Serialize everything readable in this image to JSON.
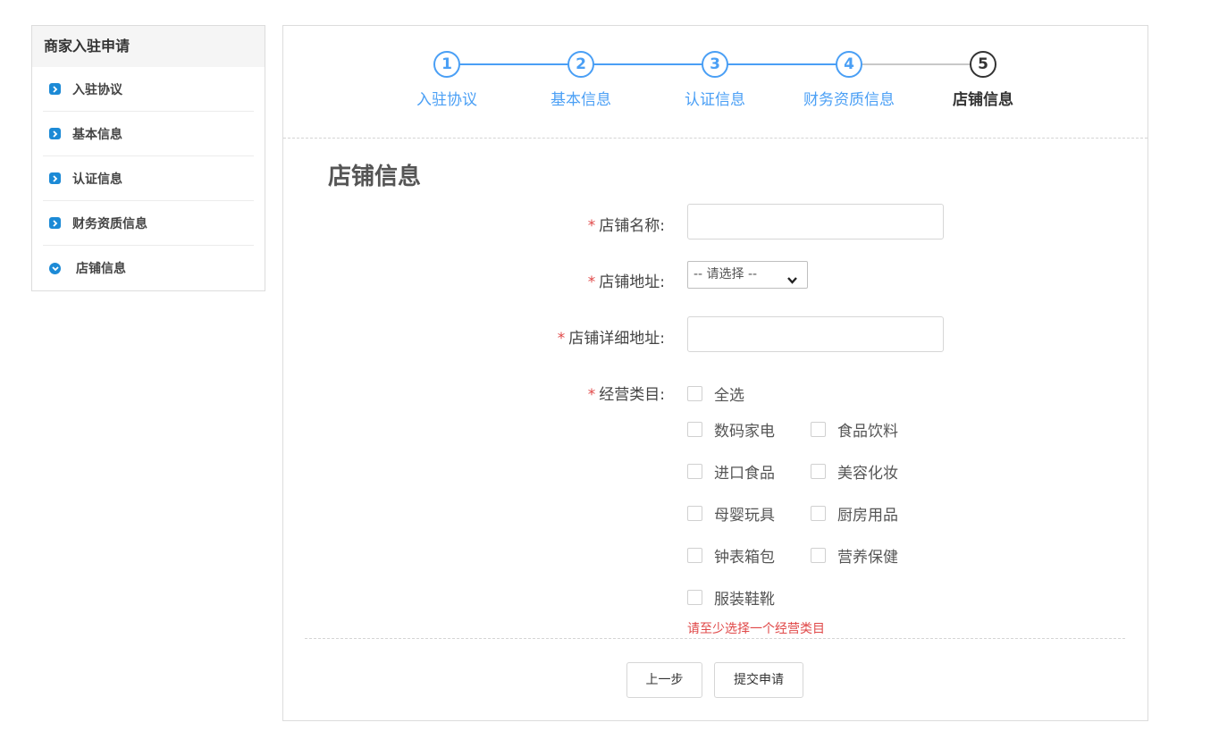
{
  "sidebar": {
    "title": "商家入驻申请",
    "items": [
      {
        "label": "入驻协议"
      },
      {
        "label": "基本信息"
      },
      {
        "label": "认证信息"
      },
      {
        "label": "财务资质信息"
      },
      {
        "label": "店铺信息"
      }
    ]
  },
  "stepper": {
    "steps": [
      {
        "number": "1",
        "label": "入驻协议"
      },
      {
        "number": "2",
        "label": "基本信息"
      },
      {
        "number": "3",
        "label": "认证信息"
      },
      {
        "number": "4",
        "label": "财务资质信息"
      },
      {
        "number": "5",
        "label": "店铺信息"
      }
    ],
    "current_step": 5
  },
  "form": {
    "title": "店铺信息",
    "required_mark": "*",
    "shop_name_label": "店铺名称:",
    "shop_name_value": "",
    "shop_address_label": "店铺地址:",
    "shop_address_select": "-- 请选择 --",
    "shop_detail_address_label": "店铺详细地址:",
    "shop_detail_address_value": "",
    "category_label": "经营类目:",
    "select_all": "全选",
    "categories": [
      "数码家电",
      "食品饮料",
      "进口食品",
      "美容化妆",
      "母婴玩具",
      "厨房用品",
      "钟表箱包",
      "营养保健",
      "服装鞋靴"
    ],
    "error": "请至少选择一个经营类目"
  },
  "buttons": {
    "prev": "上一步",
    "submit": "提交申请"
  },
  "colors": {
    "accent": "#4a9ff5",
    "sidebar_bullet": "#1c8ad6",
    "error": "#e04848",
    "pending_line": "#c8c8c8"
  }
}
